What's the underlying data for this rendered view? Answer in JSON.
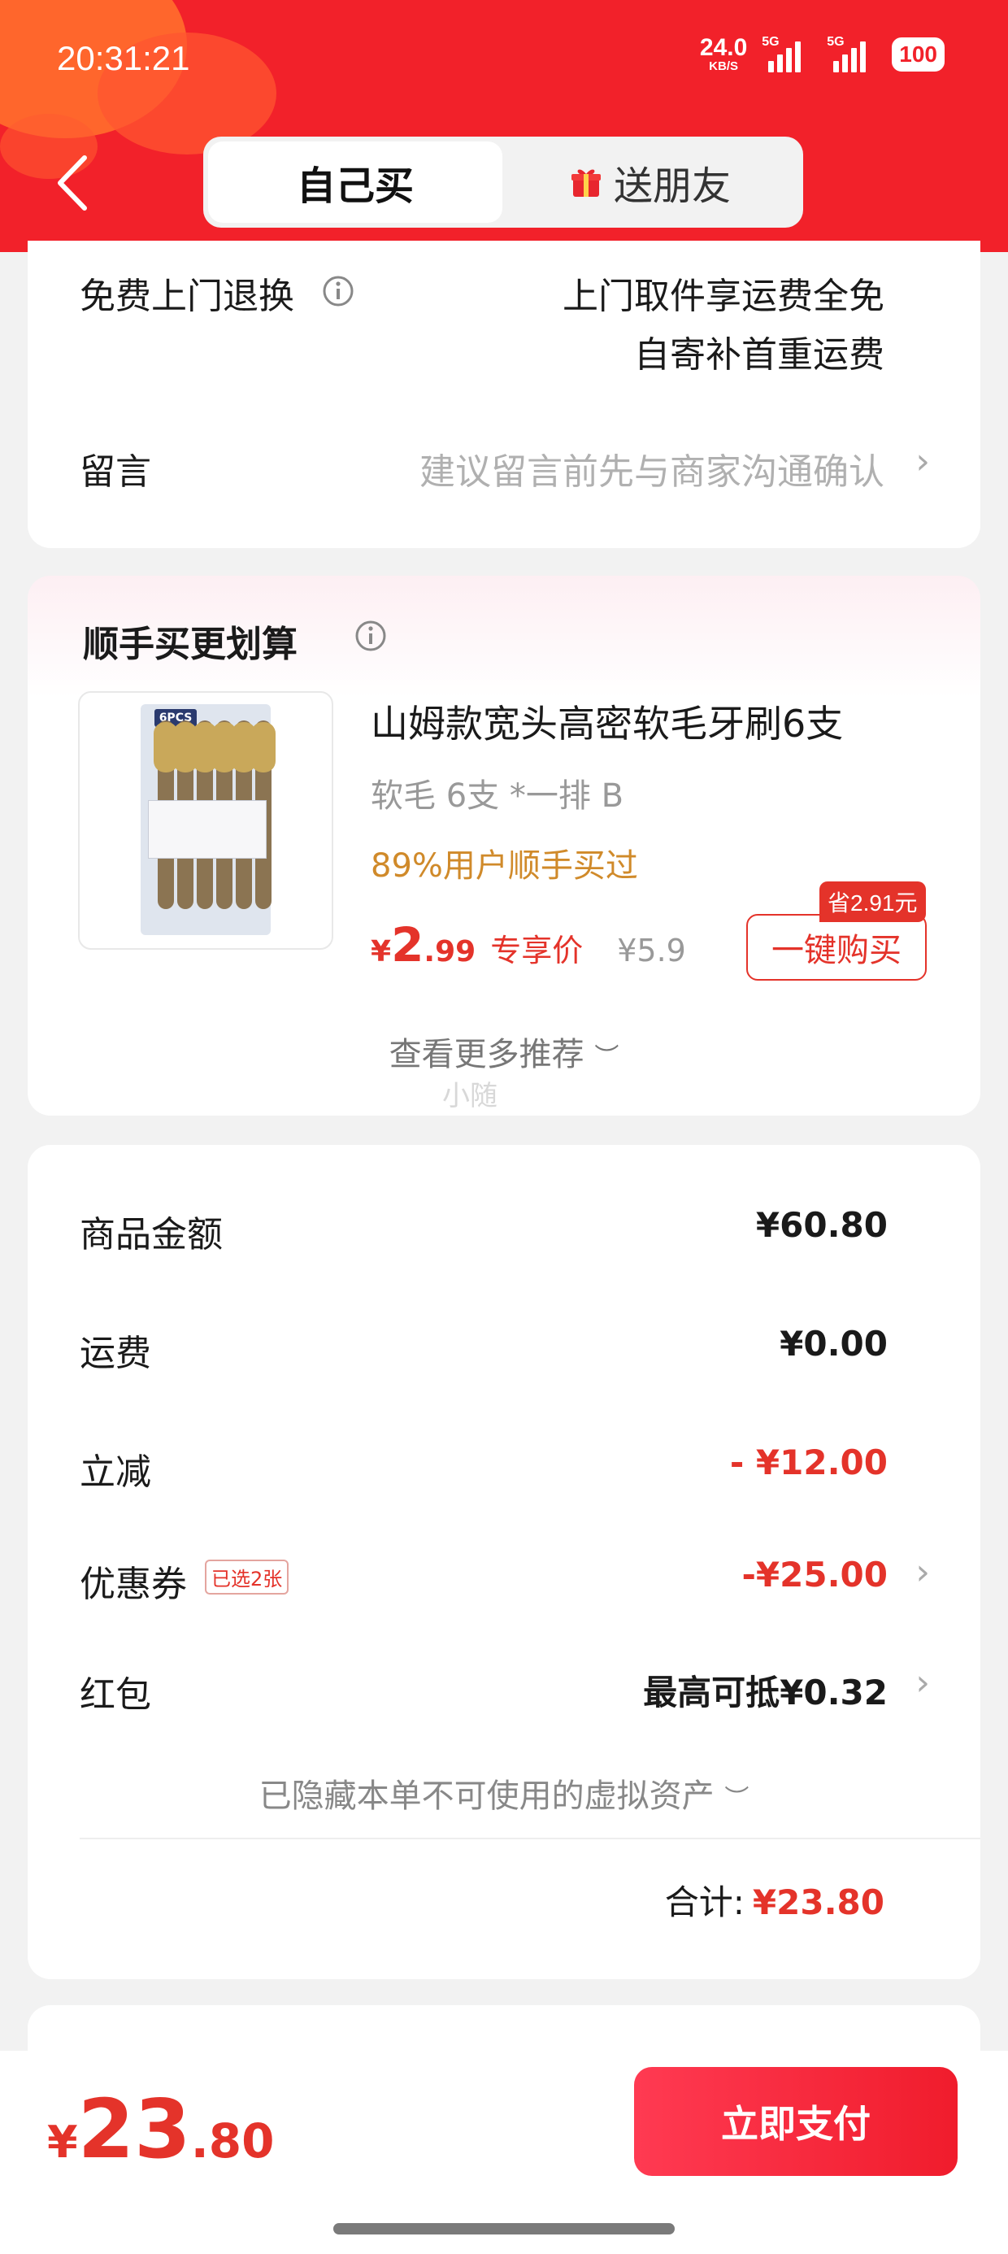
{
  "status_bar": {
    "time": "20:31:21",
    "net_speed": "24.0",
    "net_unit": "KB/S",
    "sim1": "5G",
    "sim2": "5G",
    "battery": "100"
  },
  "header": {
    "tab_self": "自己买",
    "tab_gift": "送朋友"
  },
  "return_section": {
    "label": "免费上门退换",
    "value_line1": "上门取件享运费全免",
    "value_line2": "自寄补首重运费",
    "message_label": "留言",
    "message_placeholder": "建议留言前先与商家沟通确认"
  },
  "upsell": {
    "title": "顺手买更划算",
    "product_name": "山姆款宽头高密软毛牙刷6支",
    "product_spec": "软毛 6支 *一排 B",
    "buyers_note": "89%用户顺手买过",
    "price_symbol": "¥",
    "price_int": "2",
    "price_dec": ".99",
    "price_tag": "专享价",
    "original_price": "¥5.9",
    "save_tag": "省2.91元",
    "buy_button": "一键购买",
    "more": "查看更多推荐",
    "watermark": "小随",
    "package_label": "6PCS"
  },
  "summary": {
    "rows": [
      {
        "label": "商品金额",
        "value": "¥60.80"
      },
      {
        "label": "运费",
        "value": "¥0.00"
      },
      {
        "label": "立减",
        "value": "- ¥12.00"
      },
      {
        "label": "优惠券",
        "value": "-¥25.00",
        "tag": "已选2张"
      },
      {
        "label": "红包",
        "value": "最高可抵¥0.32"
      }
    ],
    "hidden_note": "已隐藏本单不可使用的虚拟资产",
    "total_label": "合计:",
    "total_value": "¥23.80"
  },
  "bottom": {
    "currency": "¥",
    "amount_int": "23",
    "amount_dec": ".80",
    "pay_button": "立即支付"
  },
  "colors": {
    "brand_red": "#f2212a",
    "price_red": "#e4332a",
    "buyers_orange": "#d08a2a"
  }
}
